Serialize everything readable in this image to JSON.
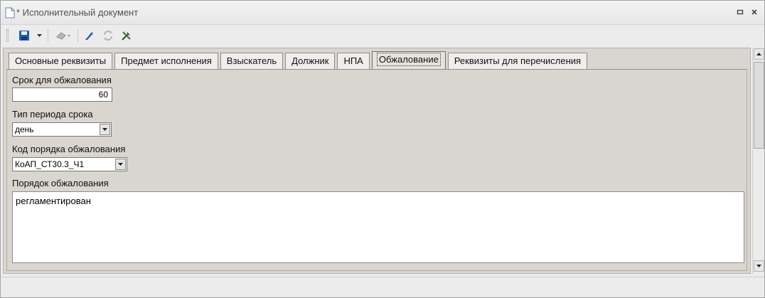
{
  "window": {
    "title": "* Исполнительный документ",
    "minimize_glyph": "▫",
    "close_glyph": "✕"
  },
  "toolbar": {
    "icons": [
      "save-icon",
      "dropdown-arrow-icon",
      "eraser-icon",
      "edit-icon",
      "refresh-icon",
      "tools-icon"
    ]
  },
  "tabs": [
    {
      "label": "Основные реквизиты",
      "active": false
    },
    {
      "label": "Предмет исполнения",
      "active": false
    },
    {
      "label": "Взыскатель",
      "active": false
    },
    {
      "label": "Должник",
      "active": false
    },
    {
      "label": "НПА",
      "active": false
    },
    {
      "label": "Обжалование",
      "active": true
    },
    {
      "label": "Реквизиты для перечисления",
      "active": false
    }
  ],
  "form": {
    "appeal_period_label": "Срок для обжалования",
    "appeal_period_value": "60",
    "period_type_label": "Тип периода срока",
    "period_type_value": "день",
    "appeal_code_label": "Код порядка обжалования",
    "appeal_code_value": "КоАП_СТ30.3_Ч1",
    "appeal_order_label": "Порядок обжалования",
    "appeal_order_value": "регламентирован"
  },
  "colors": {
    "panel_bg": "#d9d5cf",
    "window_bg": "#ececec",
    "save_icon": "#1f5fa8"
  }
}
